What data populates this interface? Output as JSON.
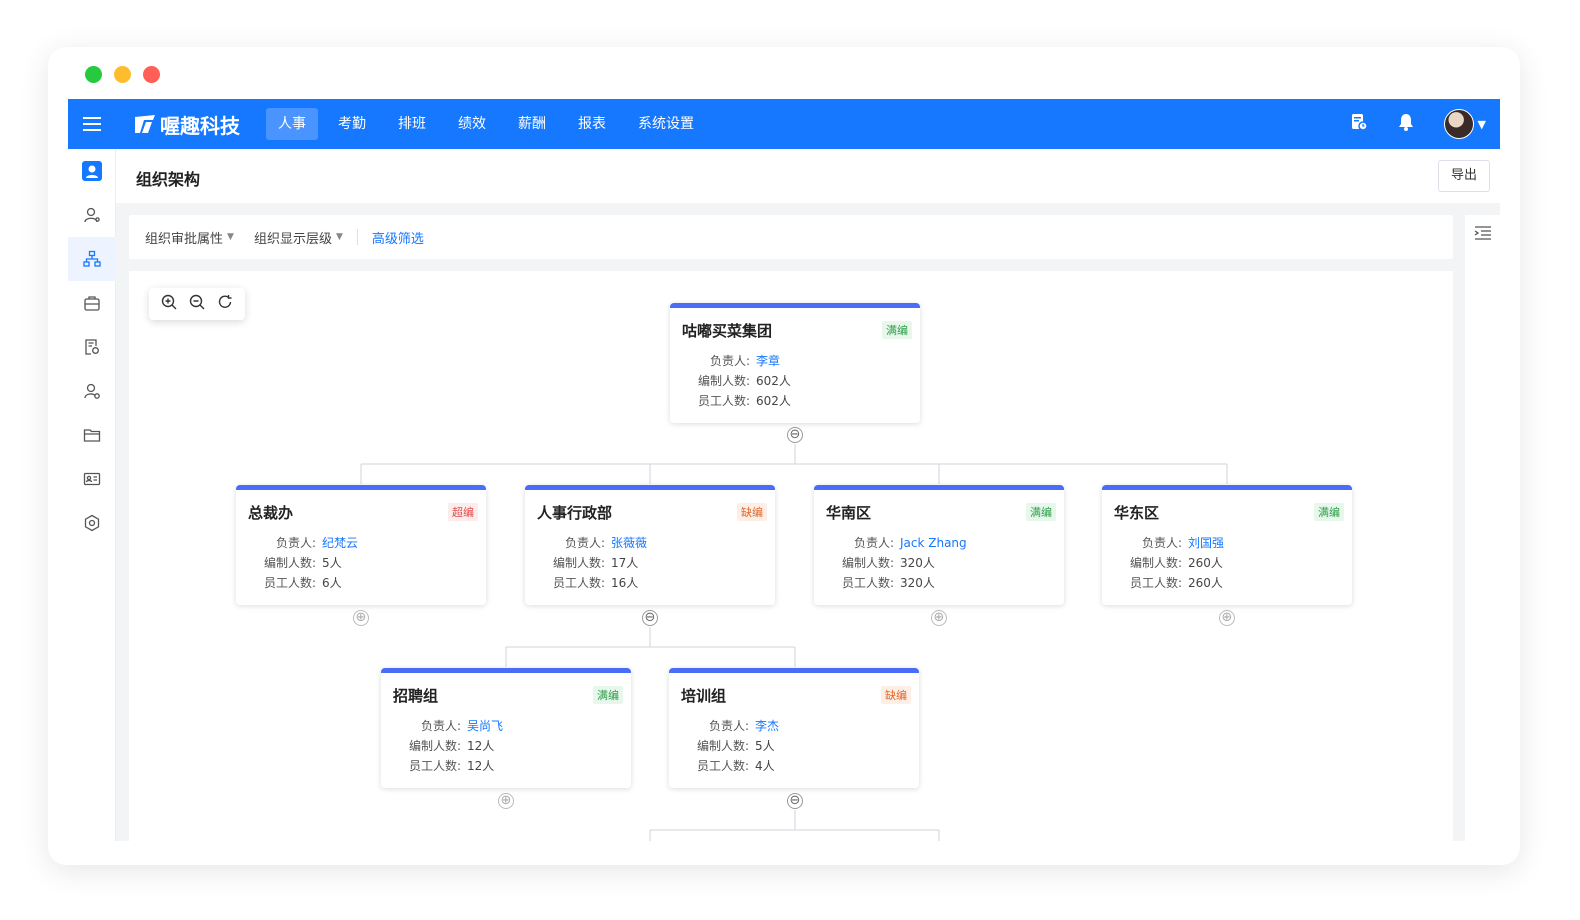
{
  "app": {
    "brand": "喔趣科技",
    "nav": [
      {
        "label": "人事",
        "active": true
      },
      {
        "label": "考勤",
        "active": false
      },
      {
        "label": "排班",
        "active": false
      },
      {
        "label": "绩效",
        "active": false
      },
      {
        "label": "薪酬",
        "active": false
      },
      {
        "label": "报表",
        "active": false
      },
      {
        "label": "系统设置",
        "active": false
      }
    ],
    "accent": "#1677ff"
  },
  "sidebar": {
    "icons": [
      "user-card-icon",
      "person-icon",
      "org-chart-icon",
      "briefcase-icon",
      "document-search-icon",
      "person-settings-icon",
      "folder-icon",
      "id-card-icon",
      "settings-hex-icon"
    ],
    "active_index": 2
  },
  "page": {
    "title": "组织架构",
    "export_label": "导出"
  },
  "filters": {
    "approval_attr": "组织审批属性",
    "display_level": "组织显示层级",
    "advanced": "高级筛选"
  },
  "labels": {
    "manager": "负责人:",
    "quota": "编制人数:",
    "staff": "员工人数:"
  },
  "org": [
    {
      "name": "咕嘟买菜集团",
      "status": "满编",
      "status_type": "full",
      "manager": "李章",
      "quota": "602人",
      "staff": "602人",
      "toggle": "⊖"
    },
    {
      "name": "总裁办",
      "status": "超编",
      "status_type": "over",
      "manager": "纪梵云",
      "quota": "5人",
      "staff": "6人",
      "toggle": "⊕"
    },
    {
      "name": "人事行政部",
      "status": "缺编",
      "status_type": "short",
      "manager": "张薇薇",
      "quota": "17人",
      "staff": "16人",
      "toggle": "⊖"
    },
    {
      "name": "华南区",
      "status": "满编",
      "status_type": "full",
      "manager": "Jack Zhang",
      "quota": "320人",
      "staff": "320人",
      "toggle": "⊕"
    },
    {
      "name": "华东区",
      "status": "满编",
      "status_type": "full",
      "manager": "刘国强",
      "quota": "260人",
      "staff": "260人",
      "toggle": "⊕"
    },
    {
      "name": "招聘组",
      "status": "满编",
      "status_type": "full",
      "manager": "吴尚飞",
      "quota": "12人",
      "staff": "12人",
      "toggle": "⊕"
    },
    {
      "name": "培训组",
      "status": "缺编",
      "status_type": "short",
      "manager": "李杰",
      "quota": "5人",
      "staff": "4人",
      "toggle": "⊖"
    }
  ]
}
